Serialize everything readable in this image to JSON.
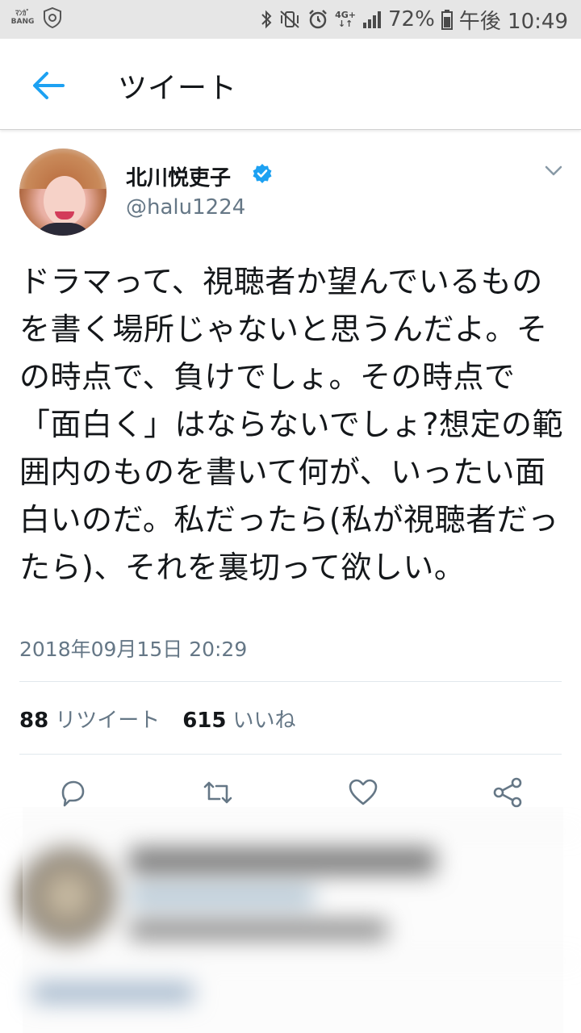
{
  "status_bar": {
    "app_badge_line1": "ﾏﾝｶﾞ",
    "app_badge_line2": "BANG",
    "network": "4G+",
    "battery": "72%",
    "time": "午後 10:49"
  },
  "header": {
    "title": "ツイート",
    "back_icon": "arrow-left-icon"
  },
  "tweet": {
    "author_name": "北川悦吏子",
    "handle": "@halu1224",
    "verified": true,
    "text": "ドラマって、視聴者か望んでいるものを書く場所じゃないと思うんだよ。その時点で、負けでしょ。その時点で「面白く」はならないでしょ?想定の範囲内のものを書いて何が、いったい面白いのだ。私だったら(私が視聴者だったら)、それを裏切って欲しい。",
    "timestamp": "2018年09月15日 20:29",
    "retweet_count": "88",
    "retweet_label": "リツイート",
    "like_count": "615",
    "like_label": "いいね"
  },
  "actions": [
    "reply-icon",
    "retweet-icon",
    "like-icon",
    "share-icon"
  ],
  "colors": {
    "accent": "#1da1f2",
    "text": "#14171a",
    "muted": "#657786",
    "status_bar_bg": "#e6e6e6"
  }
}
